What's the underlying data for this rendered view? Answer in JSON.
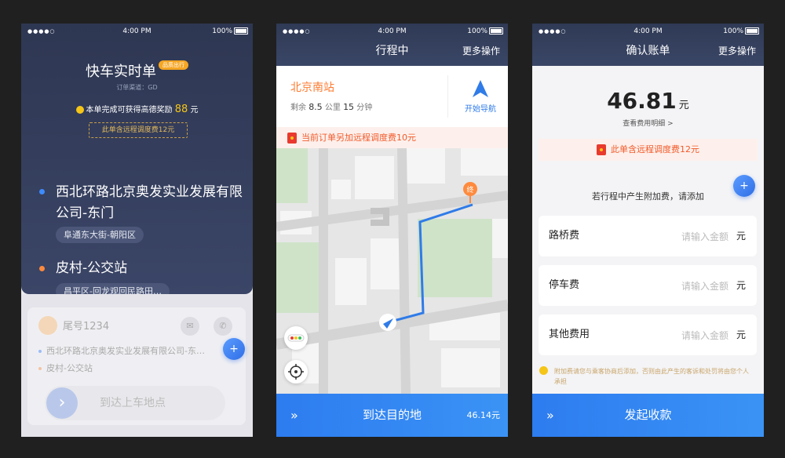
{
  "status_bar": {
    "signal": "●●●●○",
    "time": "4:00 PM",
    "battery": "100%"
  },
  "screen1": {
    "title": "快车实时单",
    "badge": "品质出行",
    "channel": "订单渠道：GD",
    "reward_prefix": "本单完成可获得高德奖励",
    "reward_amount": "88",
    "reward_unit": "元",
    "dispatch_fee": "此单含远程调度费12元",
    "pickup_name": "西北环路北京奥发实业发展有限公司-东门",
    "pickup_tag": "阜通东大街-朝阳区",
    "dropoff_name": "皮村-公交站",
    "dropoff_tag": "昌平区-回龙观回民路田…",
    "passenger": "尾号1234",
    "line_pickup": "西北环路北京奥发实业发展有限公司-东…",
    "line_dropoff": "皮村-公交站",
    "action": "到达上车地点",
    "colors": {
      "pickup_dot": "#3d8bff",
      "dropoff_dot": "#ff8a3d"
    }
  },
  "screen2": {
    "title": "行程中",
    "more": "更多操作",
    "destination": "北京南站",
    "remain_label": "剩余",
    "remain_km": "8.5",
    "km_unit": "公里",
    "remain_min": "15",
    "min_unit": "分钟",
    "nav_label": "开始导航",
    "notice": "当前订单另加远程调度费10元",
    "end_marker": "终",
    "action": "到达目的地",
    "amount": "46.14元"
  },
  "screen3": {
    "title": "确认账单",
    "more": "更多操作",
    "amount": "46.81",
    "amount_unit": "元",
    "detail_link": "查看费用明细 >",
    "dispatch_fee": "此单含远程调度费12元",
    "hint": "若行程中产生附加费，请添加",
    "fees": [
      {
        "label": "路桥费",
        "placeholder": "请输入金额",
        "unit": "元"
      },
      {
        "label": "停车费",
        "placeholder": "请输入金额",
        "unit": "元"
      },
      {
        "label": "其他费用",
        "placeholder": "请输入金额",
        "unit": "元"
      }
    ],
    "note": "附加费请您与乘客协商后添加，否则由此产生的客诉和处罚将由您个人承担",
    "action": "发起收款"
  }
}
